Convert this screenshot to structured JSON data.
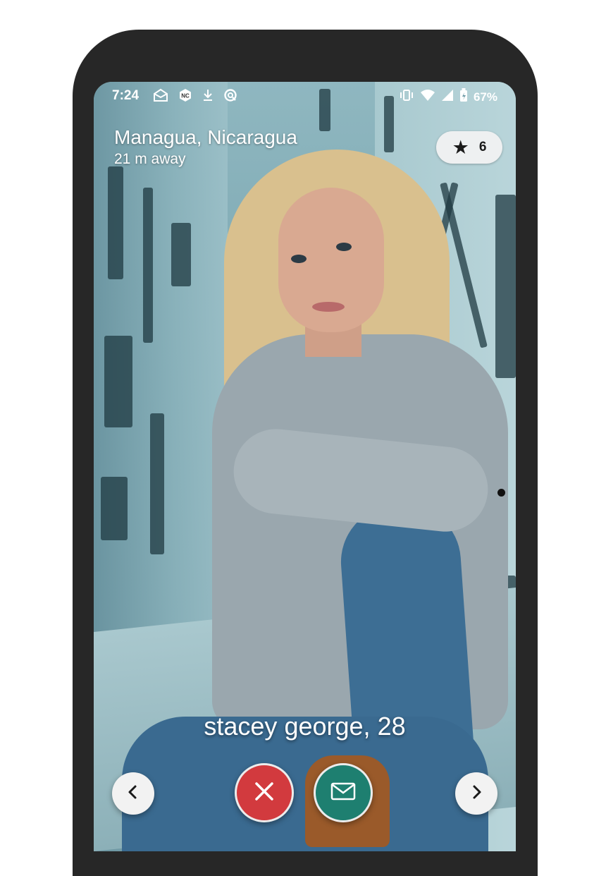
{
  "status_bar": {
    "time": "7:24",
    "battery": "67%",
    "left_icons": [
      "mail-open-icon",
      "app-badge-icon",
      "download-icon",
      "sync-icon"
    ],
    "right_icons": [
      "vibrate-icon",
      "wifi-icon",
      "signal-icon",
      "battery-icon"
    ]
  },
  "header": {
    "location": "Managua, Nicaragua",
    "distance": "21 m away",
    "star_count": "6"
  },
  "profile": {
    "name": "stacey george,",
    "age": "28"
  },
  "actions": {
    "prev_icon": "chevron-left-icon",
    "next_icon": "chevron-right-icon",
    "reject_icon": "close-icon",
    "message_icon": "envelope-icon"
  },
  "colors": {
    "reject": "#d23a3e",
    "message": "#1e7f70",
    "pill": "#eef0f1"
  }
}
